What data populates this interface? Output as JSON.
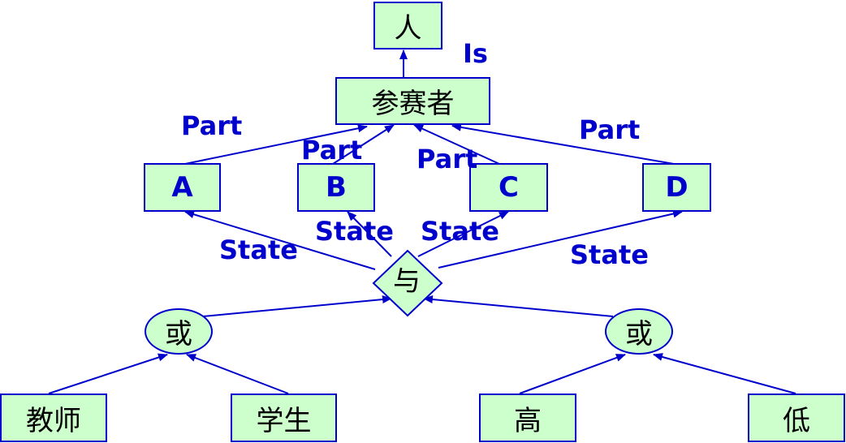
{
  "colors": {
    "node_fill": "#ccffcc",
    "line": "#0000cc",
    "label": "#0000cc"
  },
  "nodes": {
    "ren": "人",
    "participant": "参赛者",
    "a": "A",
    "b": "B",
    "c": "C",
    "d": "D",
    "and": "与",
    "or_left": "或",
    "or_right": "或",
    "teacher": "教师",
    "student": "学生",
    "high": "高",
    "low": "低"
  },
  "labels": {
    "is": "Is",
    "part_a": "Part",
    "part_b": "Part",
    "part_c": "Part",
    "part_d": "Part",
    "state_a": "State",
    "state_b": "State",
    "state_c": "State",
    "state_d": "State"
  }
}
